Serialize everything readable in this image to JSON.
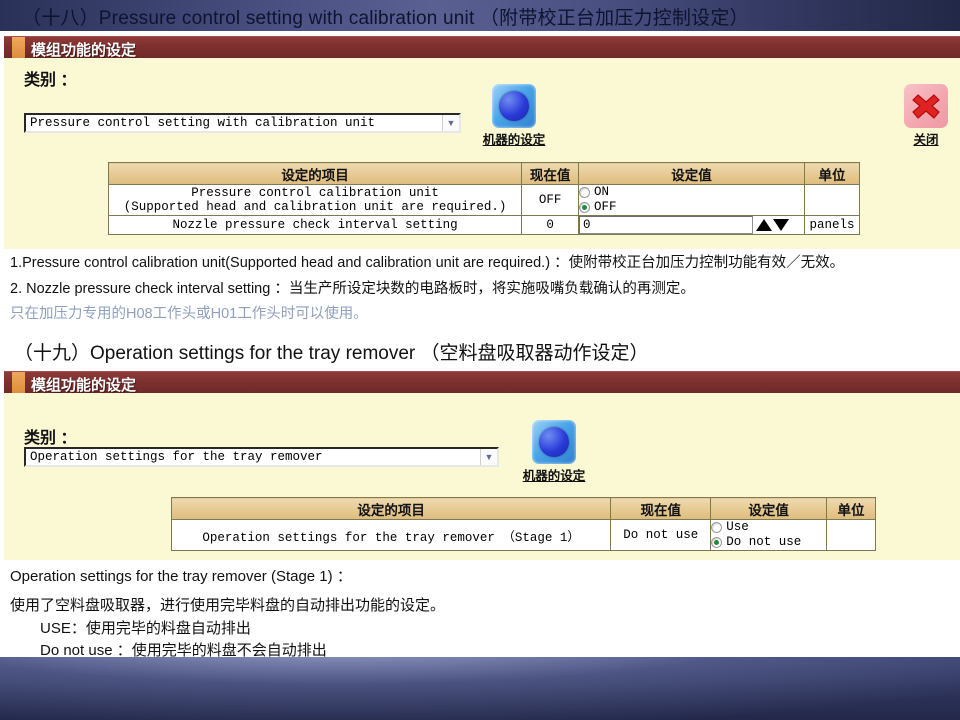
{
  "section1": {
    "title": "（十八）Pressure control setting with calibration unit （附带校正台加压力控制设定）",
    "panel_header": "模组功能的设定",
    "category_label": "类别 ：",
    "category_value": "Pressure control setting with calibration unit",
    "machine_button_label": "机器的设定",
    "close_button_label": "关闭",
    "table": {
      "headers": [
        "设定的项目",
        "现在值",
        "设定值",
        "单位"
      ],
      "rows": [
        {
          "item_line1": "Pressure control calibration unit",
          "item_line2": "(Supported head and calibration unit are required.)",
          "current": "OFF",
          "options": [
            {
              "label": "ON",
              "selected": false
            },
            {
              "label": "OFF",
              "selected": true
            }
          ],
          "unit": ""
        },
        {
          "item_line1": "Nozzle pressure check interval setting",
          "item_line2": "",
          "current": "0",
          "input_value": "0",
          "unit": "panels"
        }
      ]
    },
    "notes": [
      "1.Pressure control calibration unit(Supported head and calibration unit are required.) ：使附带校正台加压力控制功能有效／无效。",
      "2. Nozzle pressure check interval setting ：当生产所设定块数的电路板时，将实施吸嘴负载确认的再测定。",
      "只在加压力专用的H08工作头或H01工作头时可以使用。"
    ]
  },
  "section2": {
    "title": "（十九）Operation settings for the tray remover （空料盘吸取器动作设定）",
    "panel_header": "模组功能的设定",
    "category_label": "类别 ：",
    "category_value": "Operation settings for the tray remover",
    "machine_button_label": "机器的设定",
    "table": {
      "headers": [
        "设定的项目",
        "现在值",
        "设定值",
        "单位"
      ],
      "rows": [
        {
          "item": "Operation settings for the tray remover （Stage 1）",
          "current": "Do not use",
          "options": [
            {
              "label": "Use",
              "selected": false
            },
            {
              "label": "Do not use",
              "selected": true
            }
          ],
          "unit": ""
        }
      ]
    },
    "descriptions": [
      "Operation settings for the tray remover (Stage 1) ：",
      "使用了空料盘吸取器，进行使用完毕料盘的自动排出功能的设定。",
      "　　USE：使用完毕的料盘自动排出",
      "　　Do not use ：使用完毕的料盘不会自动排出"
    ]
  },
  "icons": {
    "dropdown_arrow": "▼",
    "spin_up": "▲",
    "spin_down": "▼"
  },
  "colors": {
    "panel_header": "#7f312f",
    "panel_accent": "#dd8c3c",
    "panel_body": "#fbf8d4",
    "table_header": "#e6c992",
    "radio_selected": "#1f8b3c",
    "muted_text": "#8fa0bd",
    "band": "#2b3156"
  }
}
